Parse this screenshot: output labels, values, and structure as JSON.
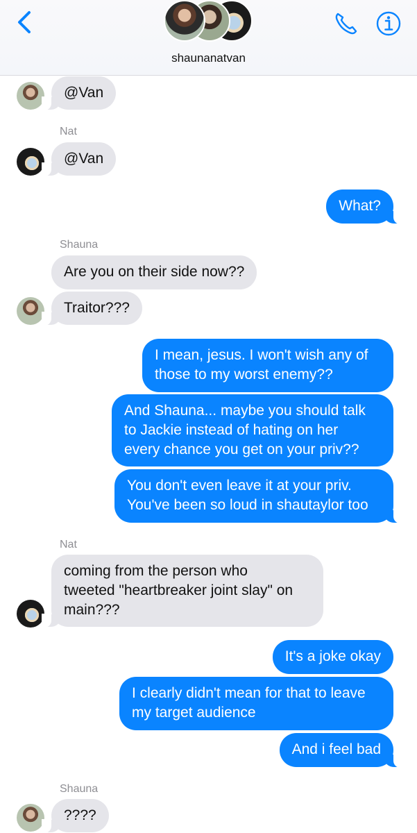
{
  "header": {
    "title": "shaunanatvan"
  },
  "colors": {
    "outgoing": "#0a84ff",
    "incoming": "#e5e5ea",
    "accent": "#0a84ff"
  },
  "messages": [
    {
      "text": "@Van"
    },
    {
      "sender": "Nat"
    },
    {
      "text": "@Van"
    },
    {
      "text": "What?"
    },
    {
      "sender": "Shauna"
    },
    {
      "text": "Are you on their side now??"
    },
    {
      "text": "Traitor???"
    },
    {
      "line1": "I mean, jesus. I won't wish any of",
      "line2": "those to my worst enemy??"
    },
    {
      "line1": "And Shauna... maybe you should talk",
      "line2": "to Jackie instead of hating on her",
      "line3": "every chance you get on your priv??"
    },
    {
      "line1": "You don't even leave it at your priv.",
      "line2": "You've been so loud in shautaylor too"
    },
    {
      "sender": "Nat"
    },
    {
      "line1": "coming from the person who",
      "line2": "tweeted \"heartbreaker joint slay\" on",
      "line3": "main???"
    },
    {
      "text": "It's a joke okay"
    },
    {
      "line1": "I clearly didn't mean for that to leave",
      "line2": "my target audience"
    },
    {
      "text": "And i feel bad"
    },
    {
      "sender": "Shauna"
    },
    {
      "text": "????"
    }
  ]
}
